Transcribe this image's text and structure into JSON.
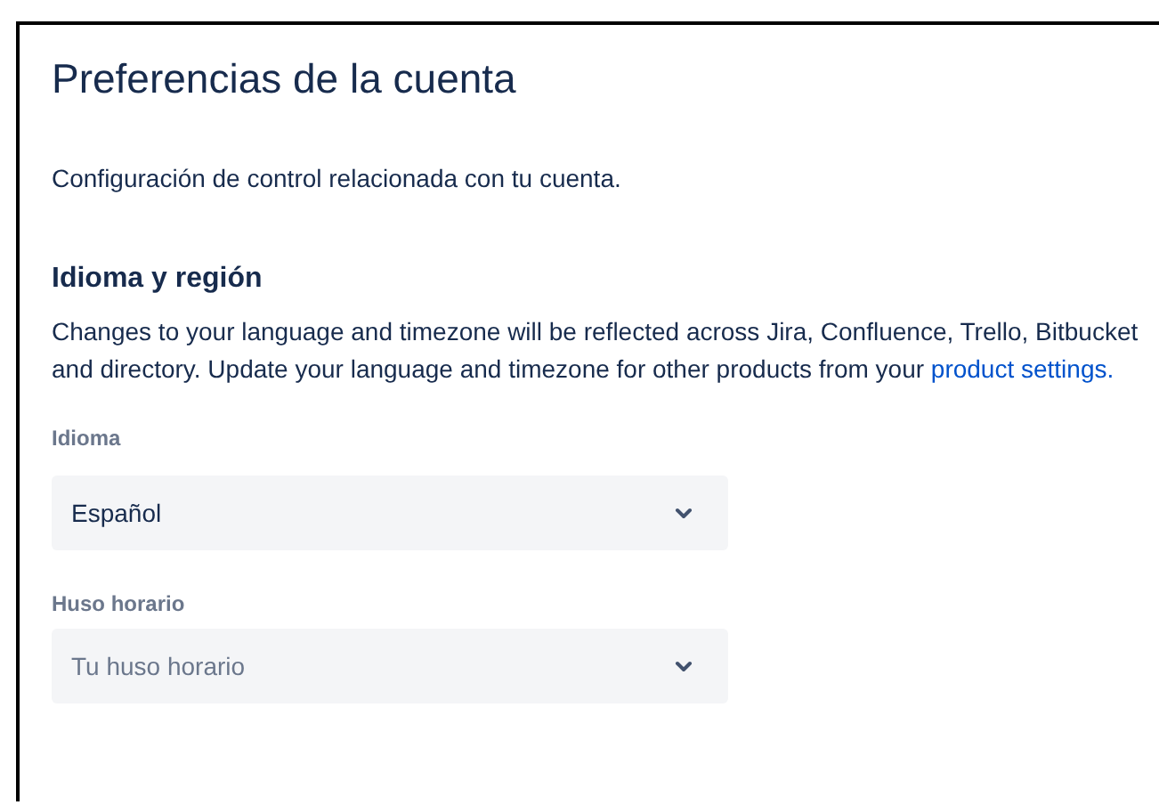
{
  "title": "Preferencias de la cuenta",
  "description": "Configuración de control relacionada con tu cuenta.",
  "section": {
    "heading": "Idioma y región",
    "text": "Changes to your language and timezone will be reflected across Jira, Confluence, Trello, Bitbucket and directory. Update your language and timezone for other products from your",
    "link": "product settings."
  },
  "fields": [
    {
      "label": "Idioma",
      "value": "Español"
    },
    {
      "label": "Huso horario",
      "placeholder": "Tu huso horario"
    }
  ]
}
